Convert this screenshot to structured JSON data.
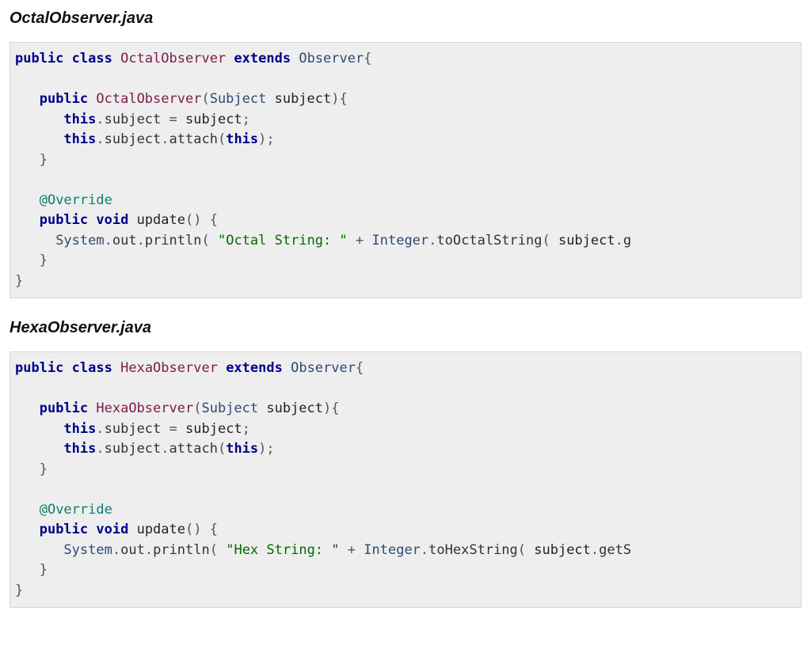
{
  "files": [
    {
      "title": "OctalObserver.java",
      "tokens": [
        [
          "kw",
          "public"
        ],
        [
          "plain",
          " "
        ],
        [
          "kw",
          "class"
        ],
        [
          "plain",
          " "
        ],
        [
          "typ",
          "OctalObserver"
        ],
        [
          "plain",
          " "
        ],
        [
          "kw",
          "extends"
        ],
        [
          "plain",
          " "
        ],
        [
          "usr",
          "Observer"
        ],
        [
          "sym",
          "{"
        ],
        [
          "nl",
          ""
        ],
        [
          "nl",
          ""
        ],
        [
          "plain",
          "   "
        ],
        [
          "kw",
          "public"
        ],
        [
          "plain",
          " "
        ],
        [
          "typ",
          "OctalObserver"
        ],
        [
          "sym",
          "("
        ],
        [
          "usr",
          "Subject"
        ],
        [
          "plain",
          " subject"
        ],
        [
          "sym",
          ")"
        ],
        [
          "sym",
          "{"
        ],
        [
          "nl",
          ""
        ],
        [
          "plain",
          "      "
        ],
        [
          "kw",
          "this"
        ],
        [
          "sym",
          "."
        ],
        [
          "mem",
          "subject"
        ],
        [
          "plain",
          " "
        ],
        [
          "sym",
          "="
        ],
        [
          "plain",
          " subject"
        ],
        [
          "sym",
          ";"
        ],
        [
          "nl",
          ""
        ],
        [
          "plain",
          "      "
        ],
        [
          "kw",
          "this"
        ],
        [
          "sym",
          "."
        ],
        [
          "mem",
          "subject"
        ],
        [
          "sym",
          "."
        ],
        [
          "mem",
          "attach"
        ],
        [
          "sym",
          "("
        ],
        [
          "kw",
          "this"
        ],
        [
          "sym",
          ")"
        ],
        [
          "sym",
          ";"
        ],
        [
          "nl",
          ""
        ],
        [
          "plain",
          "   "
        ],
        [
          "sym",
          "}"
        ],
        [
          "nl",
          ""
        ],
        [
          "nl",
          ""
        ],
        [
          "plain",
          "   "
        ],
        [
          "ann",
          "@Override"
        ],
        [
          "nl",
          ""
        ],
        [
          "plain",
          "   "
        ],
        [
          "kw",
          "public"
        ],
        [
          "plain",
          " "
        ],
        [
          "kw",
          "void"
        ],
        [
          "plain",
          " update"
        ],
        [
          "sym",
          "("
        ],
        [
          "sym",
          ")"
        ],
        [
          "plain",
          " "
        ],
        [
          "sym",
          "{"
        ],
        [
          "nl",
          ""
        ],
        [
          "plain",
          "     "
        ],
        [
          "usr",
          "System"
        ],
        [
          "sym",
          "."
        ],
        [
          "mem",
          "out"
        ],
        [
          "sym",
          "."
        ],
        [
          "mem",
          "println"
        ],
        [
          "sym",
          "("
        ],
        [
          "plain",
          " "
        ],
        [
          "lit",
          "\"Octal String: \""
        ],
        [
          "plain",
          " "
        ],
        [
          "sym",
          "+"
        ],
        [
          "plain",
          " "
        ],
        [
          "usr",
          "Integer"
        ],
        [
          "sym",
          "."
        ],
        [
          "mem",
          "toOctalString"
        ],
        [
          "sym",
          "("
        ],
        [
          "plain",
          " subject"
        ],
        [
          "sym",
          "."
        ],
        [
          "mem",
          "g"
        ],
        [
          "nl",
          ""
        ],
        [
          "plain",
          "   "
        ],
        [
          "sym",
          "}"
        ],
        [
          "nl",
          ""
        ],
        [
          "sym",
          "}"
        ]
      ]
    },
    {
      "title": "HexaObserver.java",
      "tokens": [
        [
          "kw",
          "public"
        ],
        [
          "plain",
          " "
        ],
        [
          "kw",
          "class"
        ],
        [
          "plain",
          " "
        ],
        [
          "typ",
          "HexaObserver"
        ],
        [
          "plain",
          " "
        ],
        [
          "kw",
          "extends"
        ],
        [
          "plain",
          " "
        ],
        [
          "usr",
          "Observer"
        ],
        [
          "sym",
          "{"
        ],
        [
          "nl",
          ""
        ],
        [
          "nl",
          ""
        ],
        [
          "plain",
          "   "
        ],
        [
          "kw",
          "public"
        ],
        [
          "plain",
          " "
        ],
        [
          "typ",
          "HexaObserver"
        ],
        [
          "sym",
          "("
        ],
        [
          "usr",
          "Subject"
        ],
        [
          "plain",
          " subject"
        ],
        [
          "sym",
          ")"
        ],
        [
          "sym",
          "{"
        ],
        [
          "nl",
          ""
        ],
        [
          "plain",
          "      "
        ],
        [
          "kw",
          "this"
        ],
        [
          "sym",
          "."
        ],
        [
          "mem",
          "subject"
        ],
        [
          "plain",
          " "
        ],
        [
          "sym",
          "="
        ],
        [
          "plain",
          " subject"
        ],
        [
          "sym",
          ";"
        ],
        [
          "nl",
          ""
        ],
        [
          "plain",
          "      "
        ],
        [
          "kw",
          "this"
        ],
        [
          "sym",
          "."
        ],
        [
          "mem",
          "subject"
        ],
        [
          "sym",
          "."
        ],
        [
          "mem",
          "attach"
        ],
        [
          "sym",
          "("
        ],
        [
          "kw",
          "this"
        ],
        [
          "sym",
          ")"
        ],
        [
          "sym",
          ";"
        ],
        [
          "nl",
          ""
        ],
        [
          "plain",
          "   "
        ],
        [
          "sym",
          "}"
        ],
        [
          "nl",
          ""
        ],
        [
          "nl",
          ""
        ],
        [
          "plain",
          "   "
        ],
        [
          "ann",
          "@Override"
        ],
        [
          "nl",
          ""
        ],
        [
          "plain",
          "   "
        ],
        [
          "kw",
          "public"
        ],
        [
          "plain",
          " "
        ],
        [
          "kw",
          "void"
        ],
        [
          "plain",
          " update"
        ],
        [
          "sym",
          "("
        ],
        [
          "sym",
          ")"
        ],
        [
          "plain",
          " "
        ],
        [
          "sym",
          "{"
        ],
        [
          "nl",
          ""
        ],
        [
          "plain",
          "      "
        ],
        [
          "usr",
          "System"
        ],
        [
          "sym",
          "."
        ],
        [
          "mem",
          "out"
        ],
        [
          "sym",
          "."
        ],
        [
          "mem",
          "println"
        ],
        [
          "sym",
          "("
        ],
        [
          "plain",
          " "
        ],
        [
          "lit",
          "\"Hex String: \""
        ],
        [
          "plain",
          " "
        ],
        [
          "sym",
          "+"
        ],
        [
          "plain",
          " "
        ],
        [
          "usr",
          "Integer"
        ],
        [
          "sym",
          "."
        ],
        [
          "mem",
          "toHexString"
        ],
        [
          "sym",
          "("
        ],
        [
          "plain",
          " subject"
        ],
        [
          "sym",
          "."
        ],
        [
          "mem",
          "getS"
        ],
        [
          "nl",
          ""
        ],
        [
          "plain",
          "   "
        ],
        [
          "sym",
          "}"
        ],
        [
          "nl",
          ""
        ],
        [
          "sym",
          "}"
        ]
      ]
    }
  ]
}
